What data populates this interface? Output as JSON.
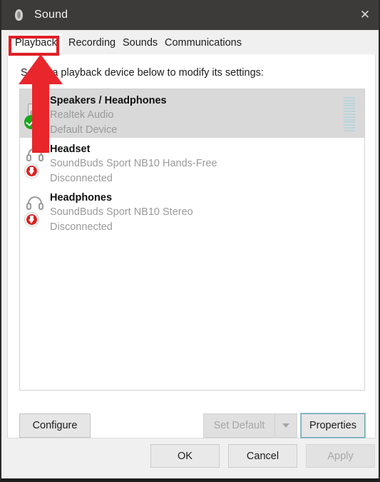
{
  "window": {
    "title": "Sound",
    "app_icon": "speaker-icon",
    "close_label": "✕"
  },
  "tabs": [
    {
      "label": "Playback",
      "active": true
    },
    {
      "label": "Recording",
      "active": false
    },
    {
      "label": "Sounds",
      "active": false
    },
    {
      "label": "Communications",
      "active": false
    }
  ],
  "panel": {
    "instruction": "Select a playback device below to modify its settings:"
  },
  "devices": [
    {
      "name": "Speakers / Headphones",
      "driver": "Realtek Audio",
      "status": "Default Device",
      "selected": true,
      "icon": "speaker-icon",
      "badge": "default-device-check",
      "meter_segments": 13
    },
    {
      "name": "Headset",
      "driver": "SoundBuds Sport NB10 Hands-Free",
      "status": "Disconnected",
      "selected": false,
      "icon": "headphones-icon",
      "badge": "disconnected-arrow",
      "meter_segments": 0
    },
    {
      "name": "Headphones",
      "driver": "SoundBuds Sport NB10 Stereo",
      "status": "Disconnected",
      "selected": false,
      "icon": "headphones-icon",
      "badge": "disconnected-arrow",
      "meter_segments": 0
    }
  ],
  "actions": {
    "configure": "Configure",
    "set_default": "Set Default",
    "set_default_arrow": "chevron-down-icon",
    "properties": "Properties"
  },
  "dialog_buttons": {
    "ok": "OK",
    "cancel": "Cancel",
    "apply": "Apply"
  },
  "annotations": {
    "highlight_target": "Playback",
    "arrow": "up-arrow-pointing-to-playback-tab",
    "color": "#e01f26"
  },
  "colors": {
    "titlebar": "#3d3b39",
    "accent_red": "#e01f26",
    "focus_ring": "#6fa8b6",
    "default_green": "#17a81a",
    "meter_blue": "#b9d4dd",
    "selection": "#d9d9d9"
  }
}
